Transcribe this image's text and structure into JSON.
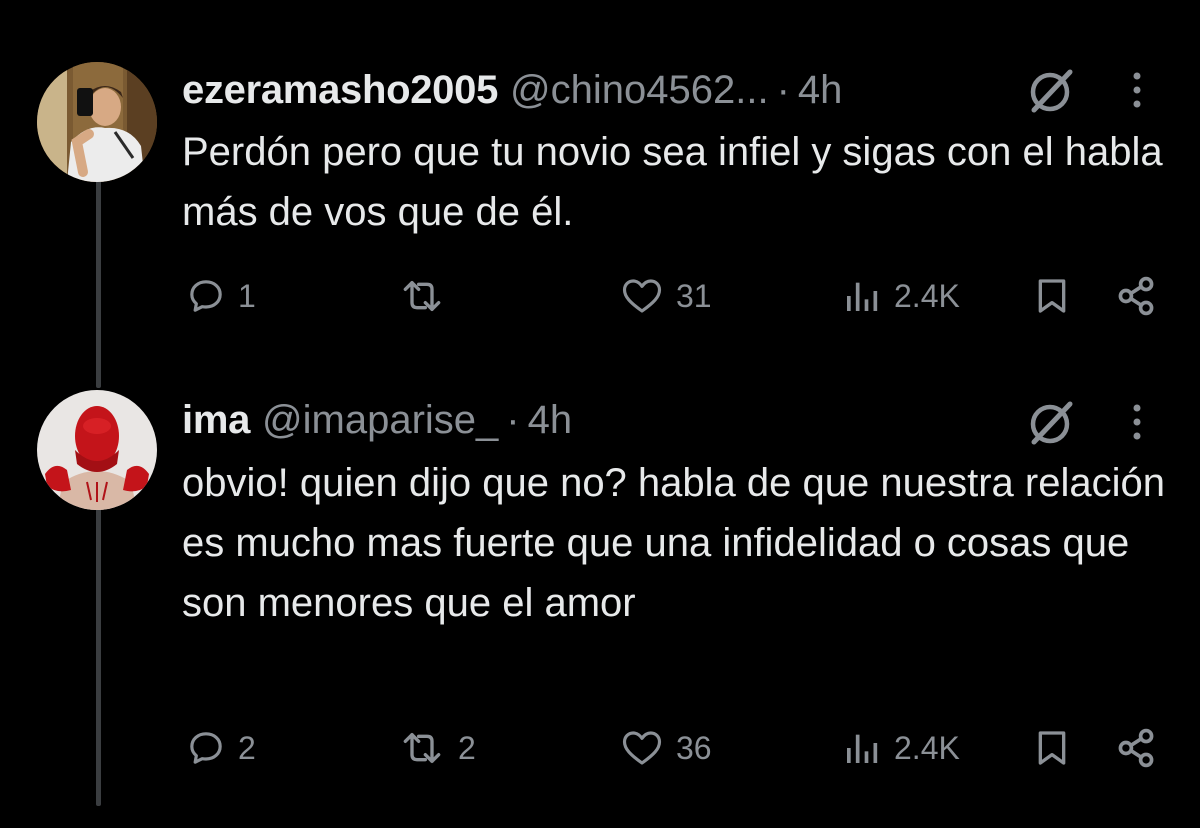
{
  "tweets": [
    {
      "display_name": "ezeramasho2005",
      "handle": "@chino4562...",
      "separator": "·",
      "time": "4h",
      "text": "Perdón pero que tu novio sea infiel y sigas con el habla más de vos que de él.",
      "avatar_icon": "avatar-photo-selfie",
      "actions": {
        "replies": "1",
        "reposts": "",
        "likes": "31",
        "views": "2.4K"
      }
    },
    {
      "display_name": "ima",
      "handle": "@imaparise_",
      "separator": "·",
      "time": "4h",
      "text": "obvio! quien dijo que no? habla de que nuestra relación es mucho mas fuerte que una infidelidad o cosas que son menores que el amor",
      "avatar_icon": "avatar-photo-red-mask",
      "actions": {
        "replies": "2",
        "reposts": "2",
        "likes": "36",
        "views": "2.4K"
      }
    }
  ],
  "icons": {
    "reply": "speech-bubble-icon",
    "repost": "repost-arrows-icon",
    "like": "heart-icon",
    "views": "bar-chart-icon",
    "bookmark": "bookmark-icon",
    "share": "share-icon",
    "grok": "grok-slash-icon",
    "more": "vertical-ellipsis-icon"
  },
  "colors": {
    "background": "#000000",
    "text": "#e7e9ea",
    "muted": "#8b9096",
    "thread_line": "#3a3d40"
  }
}
